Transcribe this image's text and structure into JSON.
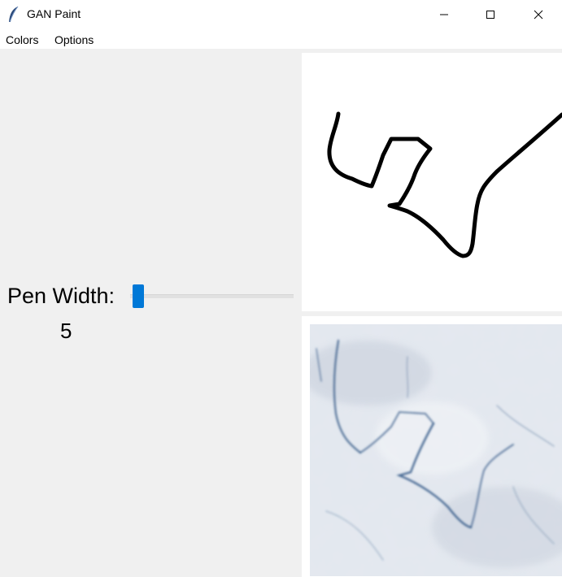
{
  "window": {
    "title": "GAN Paint",
    "icon": "feather-icon",
    "controls": [
      "minimize-icon",
      "maximize-icon",
      "close-icon"
    ]
  },
  "menu": {
    "colors": "Colors",
    "options": "Options"
  },
  "pen": {
    "label": "Pen Width:",
    "value": "5",
    "slider_fraction": 0.05,
    "accent": "#0078d7"
  },
  "canvases": {
    "drawing_background": "#ffffff",
    "stroke_color": "#000000",
    "output_palette": [
      "#dde3ec",
      "#c7d0dd",
      "#2c4f7c",
      "#9aa8bd"
    ]
  }
}
